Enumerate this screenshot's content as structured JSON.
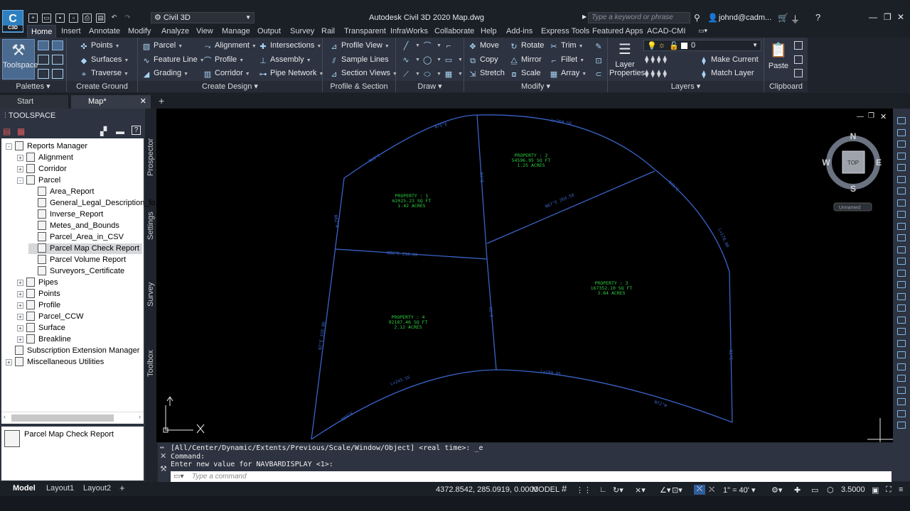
{
  "title_bar": {
    "logo_text": "C",
    "logo_sub": "C3D",
    "workspace": "Civil 3D",
    "app_title": "Autodesk Civil 3D 2020    Map.dwg",
    "search_placeholder": "Type a keyword or phrase",
    "user": "johnd@cadm..."
  },
  "menu_tabs": [
    "Home",
    "Insert",
    "Annotate",
    "Modify",
    "Analyze",
    "View",
    "Manage",
    "Output",
    "Survey",
    "Rail",
    "Transparent",
    "InfraWorks",
    "Collaborate",
    "Help",
    "Add-ins",
    "Express Tools",
    "Featured Apps",
    "ACAD-CMI"
  ],
  "ribbon": {
    "palettes": {
      "title": "Palettes",
      "toolspace": "Toolspace"
    },
    "ground": {
      "title": "Create Ground Data",
      "points": "Points",
      "surfaces": "Surfaces",
      "traverse": "Traverse"
    },
    "design": {
      "title": "Create Design",
      "parcel": "Parcel",
      "feature_line": "Feature Line",
      "grading": "Grading",
      "alignment": "Alignment",
      "profile": "Profile",
      "corridor": "Corridor",
      "intersections": "Intersections",
      "assembly": "Assembly",
      "pipe_network": "Pipe Network"
    },
    "views": {
      "title": "Profile & Section Views",
      "profile_view": "Profile View",
      "sample_lines": "Sample Lines",
      "section_views": "Section Views"
    },
    "draw": {
      "title": "Draw"
    },
    "modify": {
      "title": "Modify",
      "move": "Move",
      "rotate": "Rotate",
      "trim": "Trim",
      "copy": "Copy",
      "mirror": "Mirror",
      "fillet": "Fillet",
      "stretch": "Stretch",
      "scale": "Scale",
      "array": "Array"
    },
    "layers": {
      "title": "Layers",
      "layer_properties": "Layer Properties",
      "make_current": "Make Current",
      "match_layer": "Match Layer",
      "layer_value": "0"
    },
    "clipboard": {
      "title": "Clipboard",
      "paste": "Paste"
    }
  },
  "doc_tabs": [
    "Start",
    "Map*"
  ],
  "toolspace": {
    "title": "TOOLSPACE",
    "tree": [
      {
        "label": "Reports Manager",
        "level": 0,
        "exp": "-"
      },
      {
        "label": "Alignment",
        "level": 1,
        "exp": "+"
      },
      {
        "label": "Corridor",
        "level": 1,
        "exp": "+"
      },
      {
        "label": "Parcel",
        "level": 1,
        "exp": "-"
      },
      {
        "label": "Area_Report",
        "level": 2,
        "exp": ""
      },
      {
        "label": "General_Legal_Description_fo...",
        "level": 2,
        "exp": ""
      },
      {
        "label": "Inverse_Report",
        "level": 2,
        "exp": ""
      },
      {
        "label": "Metes_and_Bounds",
        "level": 2,
        "exp": ""
      },
      {
        "label": "Parcel_Area_in_CSV",
        "level": 2,
        "exp": ""
      },
      {
        "label": "Parcel Map Check Report",
        "level": 2,
        "exp": "",
        "selected": true
      },
      {
        "label": "Parcel Volume Report",
        "level": 2,
        "exp": ""
      },
      {
        "label": "Surveyors_Certificate",
        "level": 2,
        "exp": ""
      },
      {
        "label": "Pipes",
        "level": 1,
        "exp": "+"
      },
      {
        "label": "Points",
        "level": 1,
        "exp": "+"
      },
      {
        "label": "Profile",
        "level": 1,
        "exp": "+"
      },
      {
        "label": "Parcel_CCW",
        "level": 1,
        "exp": "+"
      },
      {
        "label": "Surface",
        "level": 1,
        "exp": "+"
      },
      {
        "label": "Breakline",
        "level": 1,
        "exp": "+"
      },
      {
        "label": "Subscription Extension Manager",
        "level": 0,
        "exp": ""
      },
      {
        "label": "Miscellaneous Utilities",
        "level": 0,
        "exp": "+"
      }
    ],
    "preview": "Parcel Map Check Report",
    "side_tabs": [
      "Prospector",
      "Settings",
      "Survey",
      "Toolbox"
    ]
  },
  "drawing": {
    "parcels": [
      {
        "name": "PROPERTY : 1",
        "area": "62025.23 SQ FT",
        "acres": "1.42 ACRES"
      },
      {
        "name": "PROPERTY : 2",
        "area": "54596.95 SQ FT",
        "acres": "1.25 ACRES"
      },
      {
        "name": "PROPERTY : 3",
        "area": "167352.10 SQ FT",
        "acres": "3.84 ACRES"
      },
      {
        "name": "PROPERTY : 4",
        "area": "92187.46 SQ FT",
        "acres": "2.12 ACRES"
      }
    ],
    "ucs_x": "X",
    "ucs_y": "Y",
    "viewcube": {
      "n": "N",
      "s": "S",
      "e": "E",
      "w": "W",
      "top": "TOP",
      "ucs": "Unnamed"
    }
  },
  "command": {
    "history": [
      "[All/Center/Dynamic/Extents/Previous/Scale/Window/Object] <real time>: _e",
      "Command:",
      "Enter new value for NAVBARDISPLAY <1>:"
    ],
    "placeholder": "Type a command"
  },
  "layout_tabs": [
    "Model",
    "Layout1",
    "Layout2"
  ],
  "status": {
    "coords": "4372.8542, 285.0919, 0.0000",
    "model": "MODEL",
    "scale": "1\" = 40'",
    "lineweight": "3.5000"
  }
}
